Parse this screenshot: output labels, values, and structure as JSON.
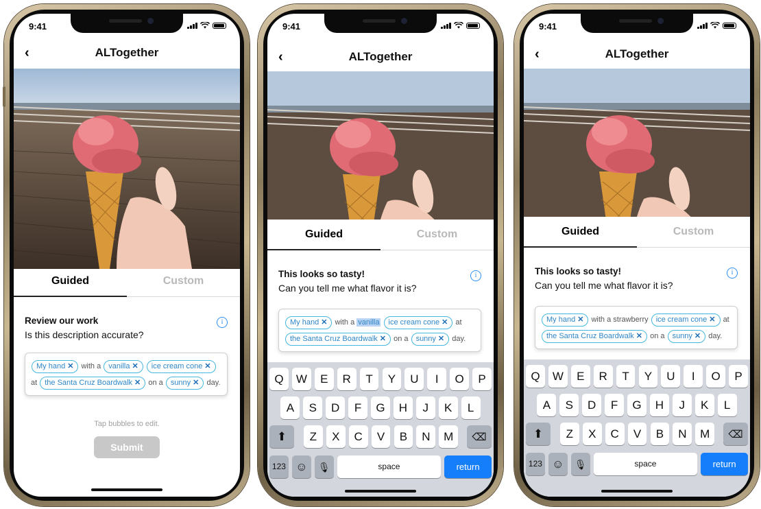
{
  "status_time": "9:41",
  "app_title": "ALTogether",
  "tabs": {
    "guided": "Guided",
    "custom": "Custom"
  },
  "phone1": {
    "prompt_heading": "Review our work",
    "prompt_question": "Is this description accurate?",
    "description": {
      "chip_hand": "My hand",
      "with_a": "with a",
      "chip_flavor": "vanilla",
      "chip_object": "ice cream cone",
      "at": "at",
      "chip_place": "the Santa Cruz Boardwalk",
      "on_a": "on a",
      "chip_weather": "sunny",
      "day": "day."
    },
    "hint": "Tap bubbles to edit.",
    "submit": "Submit"
  },
  "phone2": {
    "prompt_heading": "This looks so tasty!",
    "prompt_question": "Can you tell me what flavor it is?",
    "description": {
      "chip_hand": "My hand",
      "with_a": "with a",
      "editing_text": "vanilla",
      "chip_object": "ice cream cone",
      "at": "at",
      "chip_place": "the Santa Cruz Boardwalk",
      "on_a": "on a",
      "chip_weather": "sunny",
      "day": "day."
    }
  },
  "phone3": {
    "prompt_heading": "This looks so tasty!",
    "prompt_question": "Can you tell me what flavor it is?",
    "description": {
      "chip_hand": "My hand",
      "with_a_strawberry": "with a strawberry",
      "chip_object": "ice cream cone",
      "at": "at",
      "chip_place": "the Santa Cruz Boardwalk",
      "on_a": "on a",
      "chip_weather": "sunny",
      "day": "day."
    }
  },
  "keyboard": {
    "row1": [
      "Q",
      "W",
      "E",
      "R",
      "T",
      "Y",
      "U",
      "I",
      "O",
      "P"
    ],
    "row2": [
      "A",
      "S",
      "D",
      "F",
      "G",
      "H",
      "J",
      "K",
      "L"
    ],
    "row3": [
      "Z",
      "X",
      "C",
      "V",
      "B",
      "N",
      "M"
    ],
    "numbers": "123",
    "space": "space",
    "return": "return"
  },
  "colors": {
    "chip_border": "#44b6e0",
    "accent_blue": "#147efb",
    "submit_disabled": "#c8c8c8"
  }
}
